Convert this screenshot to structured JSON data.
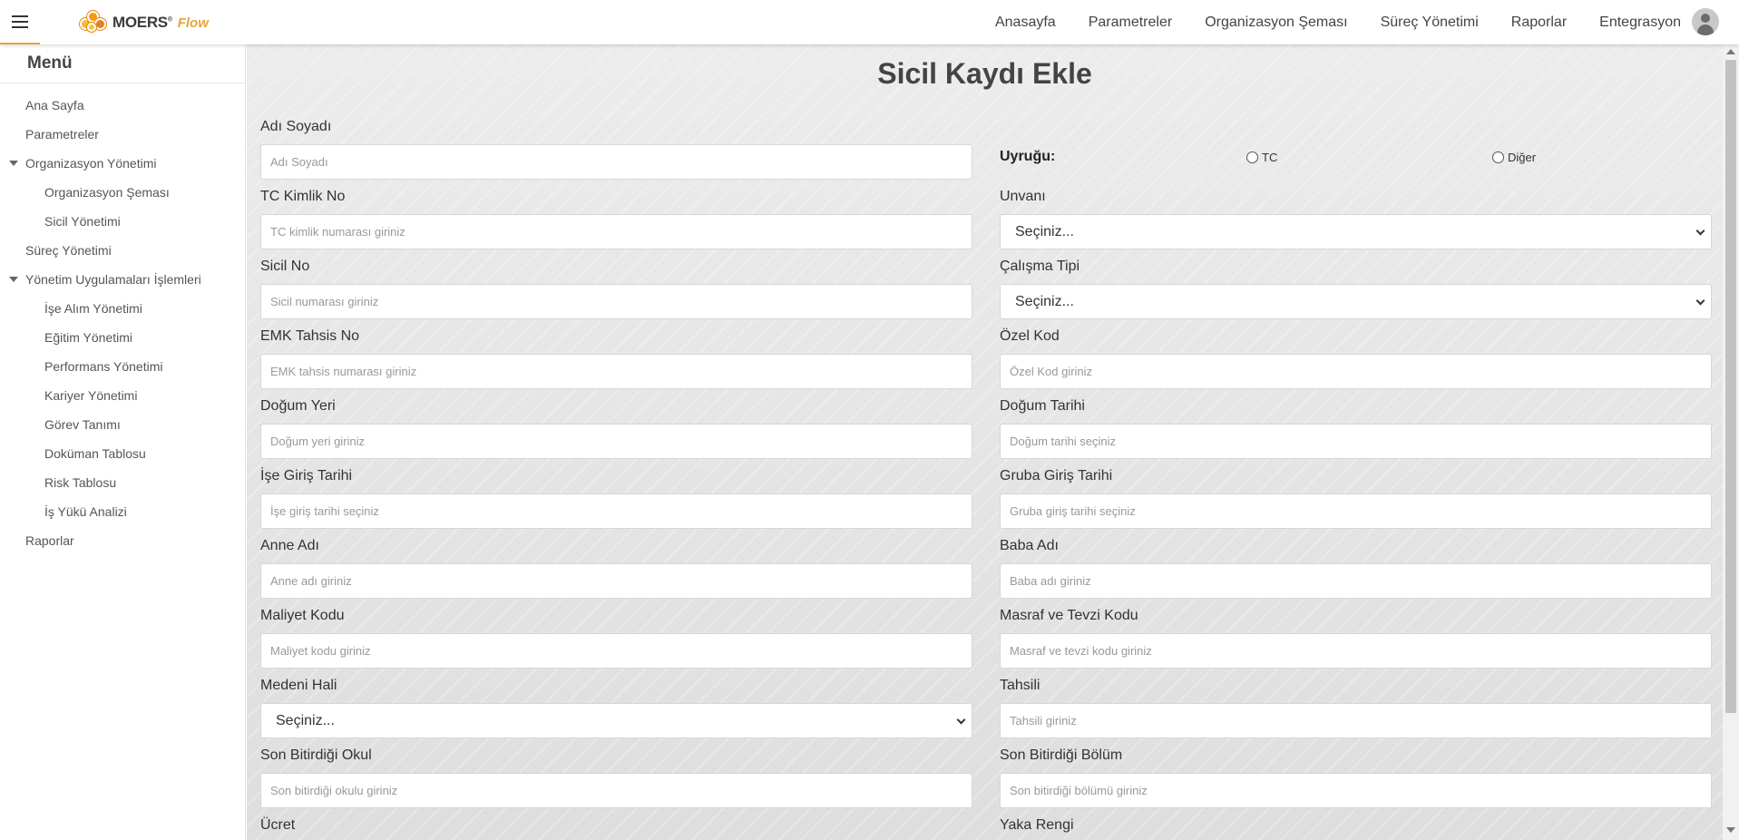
{
  "header": {
    "logo_text": "MOERS",
    "logo_sup": "®",
    "logo_flow": "Flow",
    "nav": [
      "Anasayfa",
      "Parametreler",
      "Organizasyon Şeması",
      "Süreç Yönetimi",
      "Raporlar",
      "Entegrasyon"
    ]
  },
  "sidebar": {
    "title": "Menü",
    "items": [
      {
        "label": "Ana Sayfa"
      },
      {
        "label": "Parametreler"
      },
      {
        "label": "Organizasyon Yönetimi"
      },
      {
        "label": "Organizasyon Şeması"
      },
      {
        "label": "Sicil Yönetimi"
      },
      {
        "label": "Süreç Yönetimi"
      },
      {
        "label": "Yönetim Uygulamaları İşlemleri"
      },
      {
        "label": "İşe Alım Yönetimi"
      },
      {
        "label": "Eğitim Yönetimi"
      },
      {
        "label": "Performans Yönetimi"
      },
      {
        "label": "Kariyer Yönetimi"
      },
      {
        "label": "Görev Tanımı"
      },
      {
        "label": "Doküman Tablosu"
      },
      {
        "label": "Risk Tablosu"
      },
      {
        "label": "İş Yükü Analizi"
      },
      {
        "label": "Raporlar"
      }
    ]
  },
  "form": {
    "title": "Sicil Kaydı Ekle",
    "nationality": {
      "label": "Uyruğu:",
      "options": [
        "TC",
        "Diğer"
      ]
    },
    "fields": {
      "adi_soyadi": {
        "label": "Adı Soyadı",
        "placeholder": "Adı Soyadı"
      },
      "tc_kimlik": {
        "label": "TC Kimlik No",
        "placeholder": "TC kimlik numarası giriniz"
      },
      "unvani": {
        "label": "Unvanı",
        "value": "Seçiniz..."
      },
      "sicil_no": {
        "label": "Sicil No",
        "placeholder": "Sicil numarası giriniz"
      },
      "calisma_tipi": {
        "label": "Çalışma Tipi",
        "value": "Seçiniz..."
      },
      "emk_tahsis": {
        "label": "EMK Tahsis No",
        "placeholder": "EMK tahsis numarası giriniz"
      },
      "ozel_kod": {
        "label": "Özel Kod",
        "placeholder": "Özel Kod giriniz"
      },
      "dogum_yeri": {
        "label": "Doğum Yeri",
        "placeholder": "Doğum yeri giriniz"
      },
      "dogum_tarihi": {
        "label": "Doğum Tarihi",
        "placeholder": "Doğum tarihi seçiniz"
      },
      "ise_giris": {
        "label": "İşe Giriş Tarihi",
        "placeholder": "İşe giriş tarihi seçiniz"
      },
      "gruba_giris": {
        "label": "Gruba Giriş Tarihi",
        "placeholder": "Gruba giriş tarihi seçiniz"
      },
      "anne_adi": {
        "label": "Anne Adı",
        "placeholder": "Anne adı giriniz"
      },
      "baba_adi": {
        "label": "Baba Adı",
        "placeholder": "Baba adı giriniz"
      },
      "maliyet_kodu": {
        "label": "Maliyet Kodu",
        "placeholder": "Maliyet kodu giriniz"
      },
      "masraf_kodu": {
        "label": "Masraf ve Tevzi Kodu",
        "placeholder": "Masraf ve tevzi kodu giriniz"
      },
      "medeni_hali": {
        "label": "Medeni Hali",
        "value": "Seçiniz..."
      },
      "tahsili": {
        "label": "Tahsili",
        "placeholder": "Tahsili giriniz"
      },
      "son_okul": {
        "label": "Son Bitirdiği Okul",
        "placeholder": "Son bitirdiği okulu giriniz"
      },
      "son_bolum": {
        "label": "Son Bitirdiği Bölüm",
        "placeholder": "Son bitirdiği bölümü giriniz"
      },
      "ucret": {
        "label": "Ücret"
      },
      "yaka_rengi": {
        "label": "Yaka Rengi"
      }
    }
  }
}
